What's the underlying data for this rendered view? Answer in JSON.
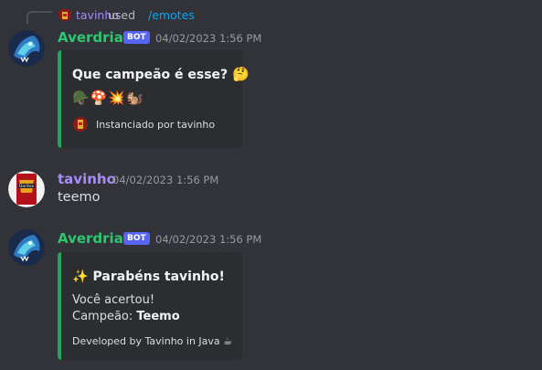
{
  "reply": {
    "user": "tavinho",
    "action": "used",
    "command": "/emotes"
  },
  "messages": [
    {
      "author": "Averdrian",
      "badge": "BOT",
      "timestamp": "04/02/2023 1:56 PM",
      "embed": {
        "title": "Que campeão é esse?",
        "title_emoji": "🤔",
        "emojis": [
          "🪖",
          "🍄",
          "💥",
          "🐿️"
        ],
        "footer": "Instanciado por tavinho"
      }
    },
    {
      "author": "tavinho",
      "timestamp": "04/02/2023 1:56 PM",
      "text": "teemo"
    },
    {
      "author": "Averdrian",
      "badge": "BOT",
      "timestamp": "04/02/2023 1:56 PM",
      "embed": {
        "title_emoji": "✨",
        "title": "Parabéns tavinho!",
        "line1": "Você acertou!",
        "line2_label": "Campeão:",
        "line2_value": "Teemo",
        "footer": "Developed by Tavinho in Java",
        "footer_emoji": "☕"
      }
    }
  ],
  "colors": {
    "background": "#313338",
    "embed_bg": "#2b2d31",
    "embed_border": "#23a55a",
    "bot_name": "#2dc770",
    "user_name": "#a78bfa",
    "badge": "#5865f2",
    "link": "#00a8fc"
  }
}
